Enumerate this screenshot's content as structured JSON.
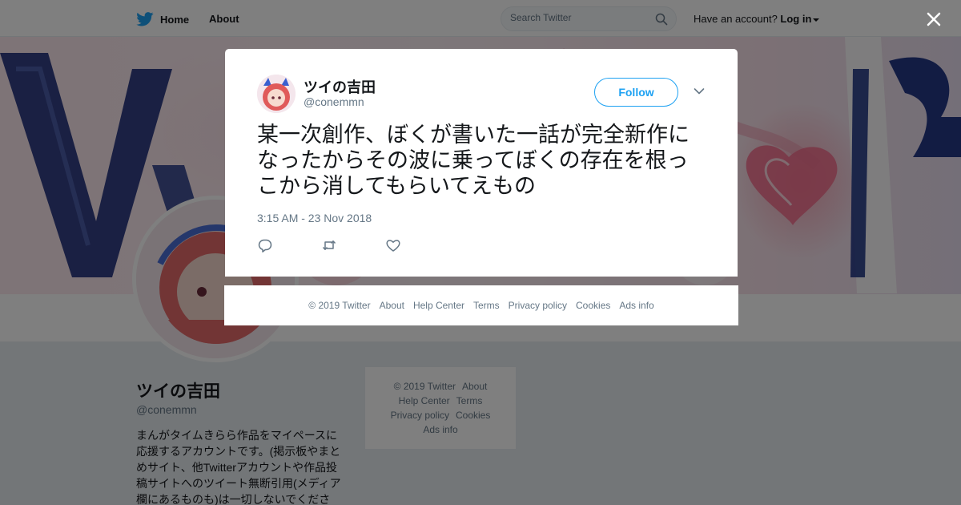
{
  "topbar": {
    "home_label": "Home",
    "about_label": "About",
    "search_placeholder": "Search Twitter",
    "account_prompt": "Have an account?",
    "login_label": "Log in"
  },
  "profile": {
    "name": "ツイの吉田",
    "handle": "@conemmn",
    "bio": "まんがタイムきらら作品をマイペースに応援するアカウントです。(掲示板やまとめサイト、他Twitterアカウントや作品投稿サイトへのツイート無断引用(メディア欄にあるものも)は一切しないでくださ"
  },
  "side_footer": {
    "copyright": "© 2019 Twitter",
    "about": "About",
    "help": "Help Center",
    "terms": "Terms",
    "privacy": "Privacy policy",
    "cookies": "Cookies",
    "ads": "Ads info"
  },
  "tweet": {
    "author_name": "ツイの吉田",
    "author_handle": "@conemmn",
    "follow_label": "Follow",
    "text": "某一次創作、ぼくが書いた一話が完全新作になったからその波に乗ってぼくの存在を根っこから消してもらいてえもの",
    "timestamp": "3:15 AM - 23 Nov 2018"
  },
  "modal_footer": {
    "copyright": "© 2019 Twitter",
    "about": "About",
    "help": "Help Center",
    "terms": "Terms",
    "privacy": "Privacy policy",
    "cookies": "Cookies",
    "ads": "Ads info"
  },
  "icons": {
    "logo": "twitter-bird-icon",
    "search": "search-icon",
    "close": "close-icon",
    "chevron": "chevron-down-icon",
    "reply": "reply-icon",
    "retweet": "retweet-icon",
    "like": "heart-icon"
  },
  "colors": {
    "brand": "#1da1f2",
    "text": "#14171a",
    "muted": "#657786"
  }
}
